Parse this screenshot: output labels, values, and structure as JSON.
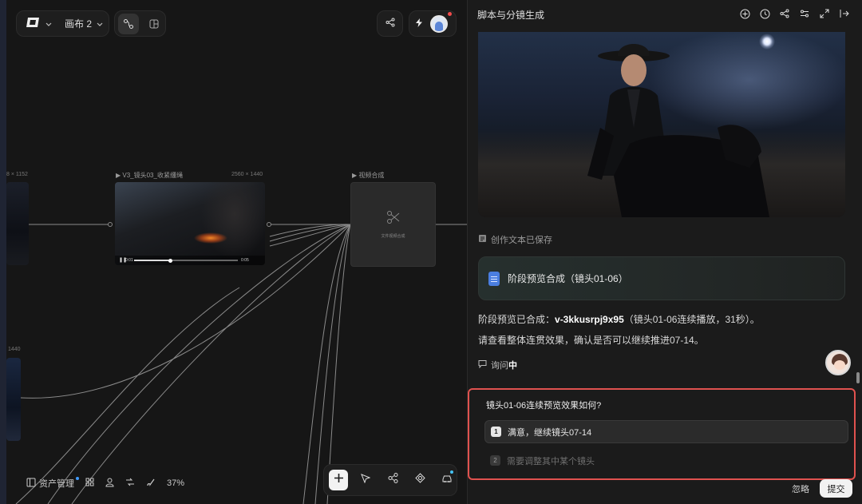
{
  "canvas": {
    "canvas_name": "画布 2",
    "nodes": {
      "left1_dim": "8 × 1152",
      "left2_dim": "1440",
      "main_label": "▶ V3_镜头03_收紧缰绳",
      "main_dim": "2560 × 1440",
      "main_time_start": "0:01",
      "main_time_end": "0:05",
      "compose_label": "▶ 视频合成",
      "compose_hint": "文件视频合成"
    },
    "bottom_bar": {
      "asset_label": "资产管理",
      "zoom": "37%"
    },
    "icons": [
      "logo-icon",
      "chevron-down-icon",
      "node-graph-icon",
      "split-view-icon",
      "share-icon",
      "lightning-icon",
      "layout-icon",
      "grid-icon",
      "person-icon",
      "shuffle-icon",
      "brush-icon",
      "plus-icon",
      "cursor-icon",
      "share-nodes-icon",
      "shapes-icon",
      "car-icon",
      "scissors-icon"
    ]
  },
  "panel": {
    "title": "脚本与分镜生成",
    "saved_label": "创作文本已保存",
    "doc_card_title": "阶段预览合成（镜头01-06）",
    "message_prefix": "阶段预览已合成：",
    "message_code": "v-3kkusrpj9x95",
    "message_suffix": "（镜头01-06连续播放，31秒）。",
    "message_line2": "请查看整体连贯效果，确认是否可以继续推进07-14。",
    "asking_prefix": "询问",
    "asking_state": "中",
    "question": {
      "title": "镜头01-06连续预览效果如何?",
      "options": [
        {
          "num": "1",
          "label": "满意，继续镜头07-14"
        },
        {
          "num": "2",
          "label": "需要调整其中某个镜头"
        }
      ]
    },
    "ignore_label": "忽略",
    "submit_label": "提交"
  },
  "colors": {
    "highlight_border": "#e0524f",
    "notification_dot": "#f24b4b",
    "info_dot": "#3f9bff"
  }
}
